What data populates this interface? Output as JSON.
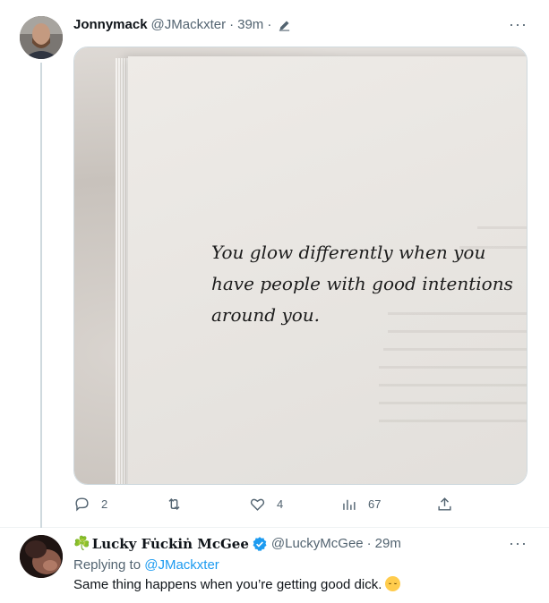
{
  "tweet1": {
    "display_name": "Jonnymack",
    "handle": "@JMackxter",
    "separator": "·",
    "time": "39m",
    "more": "···",
    "image_text": "You glow differently when you have people with good intentions around you.",
    "actions": {
      "replies": "2",
      "retweets": "",
      "likes": "4",
      "views": "67"
    }
  },
  "tweet2": {
    "display_name": "Lucky Fu̇ckiṅ McGee",
    "name_prefix_emoji": "☘️",
    "handle": "@LuckyMcGee",
    "separator": "·",
    "time": "29m",
    "more": "···",
    "replying_prefix": "Replying to",
    "replying_mention": "@JMackxter",
    "text": "Same thing happens when you’re getting good dick."
  },
  "colors": {
    "accent": "#1d9bf0",
    "secondary_text": "#536471",
    "border": "#cfd9de"
  },
  "icons": [
    "pencil-icon",
    "more-icon",
    "reply-icon",
    "retweet-icon",
    "like-icon",
    "views-icon",
    "share-icon",
    "verified-badge-icon",
    "relieved-face-emoji"
  ]
}
